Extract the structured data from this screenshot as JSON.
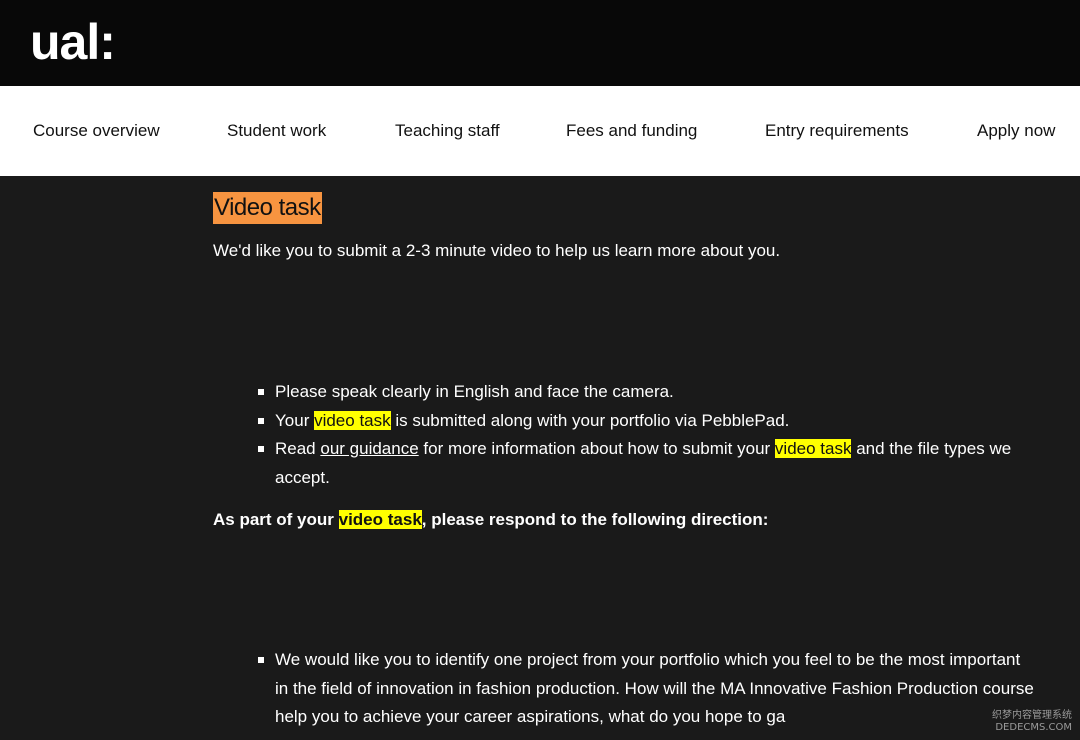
{
  "header": {
    "logo": "ual:"
  },
  "nav": {
    "items": [
      {
        "label": "Course overview"
      },
      {
        "label": "Student work"
      },
      {
        "label": "Teaching staff"
      },
      {
        "label": "Fees and funding"
      },
      {
        "label": "Entry requirements"
      },
      {
        "label": "Apply now"
      }
    ]
  },
  "content": {
    "title": "Video task",
    "intro": "We'd like you to submit a 2-3 minute video to help us learn more about you.",
    "list1": {
      "item1": "Please speak clearly in English and face the camera.",
      "item2_prefix": "Your ",
      "item2_highlight": "video task",
      "item2_suffix": " is submitted along with your portfolio via PebblePad.",
      "item3_prefix": "Read ",
      "item3_link": "our guidance",
      "item3_middle": " for more information about how to submit your ",
      "item3_highlight": "video task",
      "item3_suffix": " and the file types we accept."
    },
    "direction": {
      "prefix": "As part of your ",
      "highlight": "video task",
      "suffix": ", please respond to the following direction:"
    },
    "list2": {
      "item1": "We would like you to identify one project from your portfolio which you feel to be the most important in the field of innovation in fashion production. How will the MA Innovative Fashion Production course help you to achieve your career aspirations, what do you hope to ga"
    }
  },
  "watermark": {
    "line1": "织梦内容管理系统",
    "line2": "DEDECMS.COM"
  },
  "colors": {
    "header_bg": "#080808",
    "nav_bg": "#ffffff",
    "content_bg": "#1a1a1a",
    "title_highlight": "#f79440",
    "text_highlight": "#ffff00"
  }
}
